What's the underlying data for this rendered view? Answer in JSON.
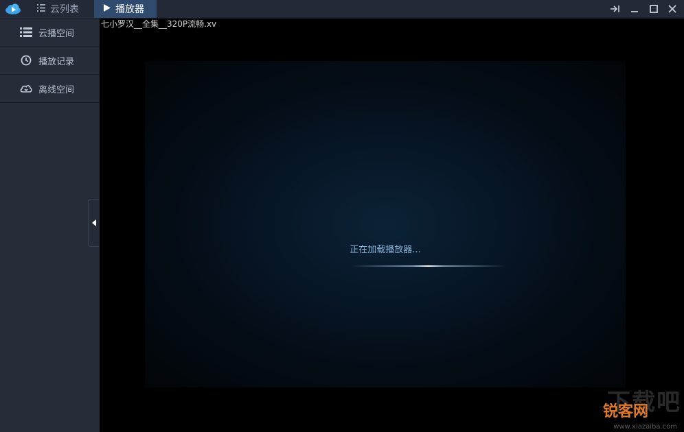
{
  "titlebar": {
    "tabs": [
      {
        "label": "云列表",
        "icon": "list-icon"
      },
      {
        "label": "播放器",
        "icon": "play-icon"
      }
    ],
    "window_buttons": [
      "pin-icon",
      "minimize-icon",
      "maximize-icon",
      "close-icon"
    ]
  },
  "sidebar": {
    "items": [
      {
        "label": "云播空间",
        "icon": "list-icon"
      },
      {
        "label": "播放记录",
        "icon": "clock-icon"
      },
      {
        "label": "离线空间",
        "icon": "cloud-download-icon"
      }
    ]
  },
  "player": {
    "filename": "七小罗汉__全集__320P流畅.xv",
    "loading_text": "正在加载播放器..."
  },
  "watermark": {
    "top": "下载吧",
    "brand": "锐客网",
    "url": "www.xiazaiba.com"
  },
  "colors": {
    "titlebar_bg": "#232937",
    "active_tab_bg": "#2f4a6c",
    "sidebar_bg": "#262c38",
    "loading_text": "#8fb6dd"
  }
}
